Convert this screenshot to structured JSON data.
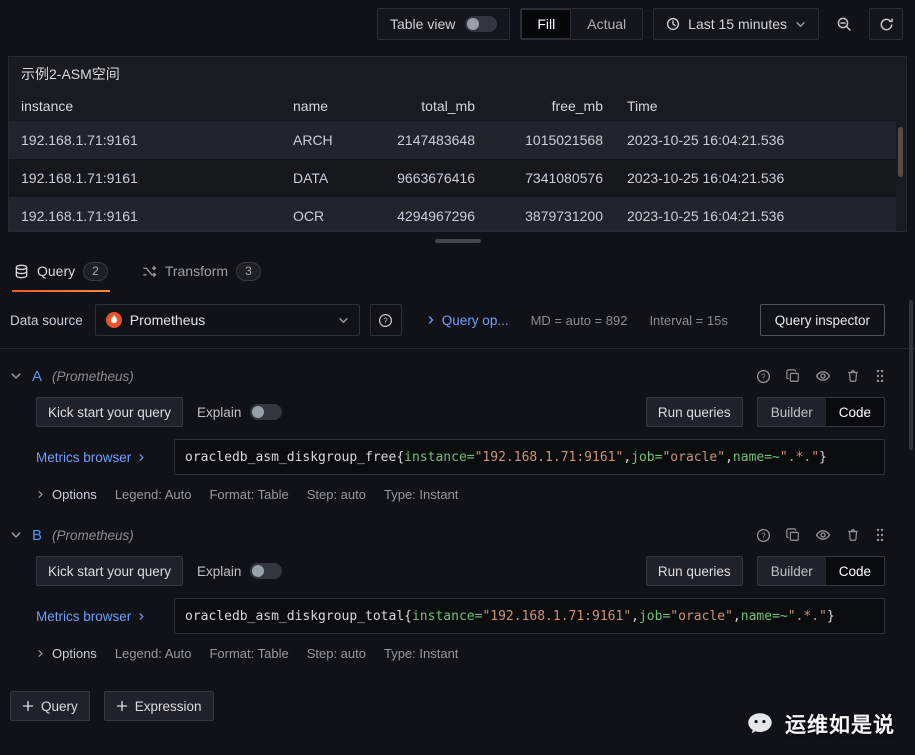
{
  "toolbar": {
    "table_view_label": "Table view",
    "size_mode": {
      "fill": "Fill",
      "actual": "Actual",
      "selected": "Fill"
    },
    "time_picker": {
      "label": "Last 15 minutes"
    }
  },
  "panel": {
    "title": "示例2-ASM空间",
    "table": {
      "columns": [
        "instance",
        "name",
        "total_mb",
        "free_mb",
        "Time"
      ],
      "rows": [
        [
          "192.168.1.71:9161",
          "ARCH",
          "2147483648",
          "1015021568",
          "2023-10-25 16:04:21.536"
        ],
        [
          "192.168.1.71:9161",
          "DATA",
          "9663676416",
          "7341080576",
          "2023-10-25 16:04:21.536"
        ],
        [
          "192.168.1.71:9161",
          "OCR",
          "4294967296",
          "3879731200",
          "2023-10-25 16:04:21.536"
        ]
      ]
    }
  },
  "tabs": {
    "query": {
      "label": "Query",
      "badge": "2"
    },
    "transform": {
      "label": "Transform",
      "badge": "3"
    }
  },
  "datasource_row": {
    "label": "Data source",
    "selected": "Prometheus",
    "query_options_label": "Query op...",
    "md_summary": "MD = auto = 892",
    "interval_summary": "Interval = 15s",
    "inspector_label": "Query inspector"
  },
  "query_ui": {
    "kick_start": "Kick start your query",
    "explain": "Explain",
    "run_queries": "Run queries",
    "builder": "Builder",
    "code": "Code",
    "metrics_browser": "Metrics browser",
    "options_label": "Options",
    "legend": "Legend: Auto",
    "format": "Format: Table",
    "step": "Step: auto",
    "type": "Type: Instant"
  },
  "queries": [
    {
      "ref": "A",
      "datasource": "(Prometheus)",
      "expr": {
        "metric": "oracledb_asm_diskgroup_free",
        "open": "{",
        "label1": "instance",
        "op1": "=",
        "val1": "\"192.168.1.71:9161\"",
        "comma1": ",",
        "label2": "job",
        "op2": "=",
        "val2": "\"oracle\"",
        "comma2": ",",
        "label3": "name",
        "op3": "=~",
        "val3": "\".*.\"",
        "close": "}"
      }
    },
    {
      "ref": "B",
      "datasource": "(Prometheus)",
      "expr": {
        "metric": "oracledb_asm_diskgroup_total",
        "open": "{",
        "label1": "instance",
        "op1": "=",
        "val1": "\"192.168.1.71:9161\"",
        "comma1": ",",
        "label2": "job",
        "op2": "=",
        "val2": "\"oracle\"",
        "comma2": ",",
        "label3": "name",
        "op3": "=~",
        "val3": "\".*.\"",
        "close": "}"
      }
    }
  ],
  "footer": {
    "add_query": "Query",
    "add_expression": "Expression"
  },
  "watermark": "运维如是说",
  "icons": {
    "time-range": "clock",
    "zoom-out": "magnifier-minus",
    "refresh": "circular-arrow",
    "query-tab": "database",
    "transform-tab": "shuffle-arrows",
    "datasource-logo": "prometheus-flame",
    "help": "question-circle",
    "duplicate": "copy",
    "hide": "eye",
    "remove": "trash",
    "drag": "grip-dots",
    "watermark": "wechat-bubble"
  },
  "colors": {
    "accent_blue": "#5794f2",
    "link_blue": "#6e9fff",
    "tab_underline": "#f05a28",
    "prometheus_orange": "#e6522c",
    "token_label": "#6fc276",
    "token_string": "#ce9178"
  }
}
